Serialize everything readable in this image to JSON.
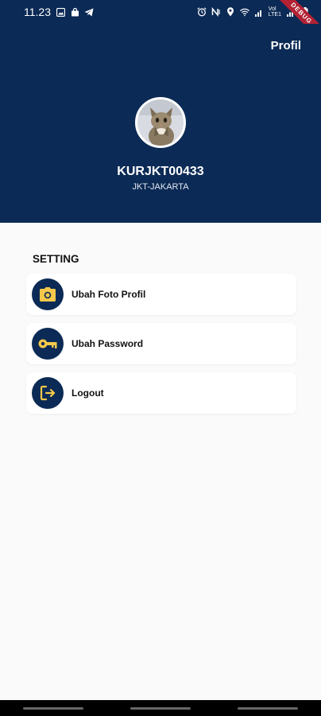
{
  "status_bar": {
    "time": "11.23",
    "signal_label": "Vol\nLTE1"
  },
  "debug_banner": "DEBUG",
  "header": {
    "title": "Profil",
    "username": "KURJKT00433",
    "region": "JKT-JAKARTA"
  },
  "settings": {
    "title": "SETTING",
    "items": [
      {
        "label": "Ubah Foto Profil",
        "icon": "camera-icon"
      },
      {
        "label": "Ubah Password",
        "icon": "key-icon"
      },
      {
        "label": "Logout",
        "icon": "logout-icon"
      }
    ]
  },
  "colors": {
    "primary": "#0b2a55",
    "accent": "#f5c84b",
    "background": "#fafafa"
  }
}
